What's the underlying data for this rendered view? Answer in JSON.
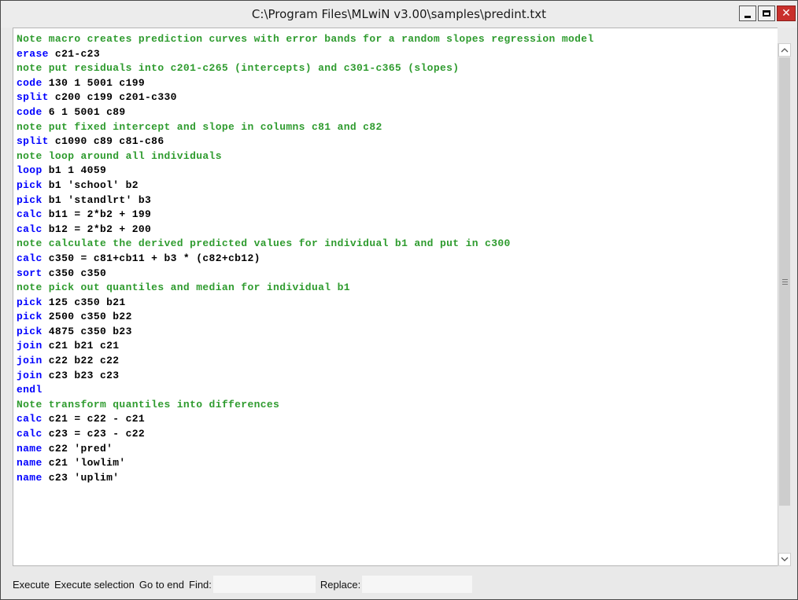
{
  "window": {
    "title": "C:\\Program Files\\MLwiN v3.00\\samples\\predint.txt",
    "controls": {
      "minimize": "minimize-icon",
      "maximize": "maximize-icon",
      "close": "close-icon"
    }
  },
  "colors": {
    "note": "#2e9b2e",
    "keyword": "#0000ff",
    "text": "#000000",
    "close": "#c9302c"
  },
  "editor": {
    "lines": [
      {
        "type": "note",
        "text": "Note macro creates prediction curves with error bands for a random slopes regression model"
      },
      {
        "type": "cmd",
        "kw": "erase",
        "rest": " c21-c23"
      },
      {
        "type": "note",
        "text": "note put residuals into c201-c265 (intercepts) and c301-c365 (slopes)"
      },
      {
        "type": "cmd",
        "kw": "code",
        "rest": " 130 1 5001 c199"
      },
      {
        "type": "cmd",
        "kw": "split",
        "rest": " c200 c199 c201-c330"
      },
      {
        "type": "cmd",
        "kw": "code",
        "rest": " 6 1 5001 c89"
      },
      {
        "type": "note",
        "text": "note put fixed intercept and slope in columns c81 and c82"
      },
      {
        "type": "cmd",
        "kw": "split",
        "rest": " c1090 c89 c81-c86"
      },
      {
        "type": "note",
        "text": "note loop around all individuals"
      },
      {
        "type": "cmd",
        "kw": "loop",
        "rest": " b1 1 4059"
      },
      {
        "type": "cmd",
        "kw": "pick",
        "rest": " b1 'school' b2"
      },
      {
        "type": "cmd",
        "kw": "pick",
        "rest": " b1 'standlrt' b3"
      },
      {
        "type": "cmd",
        "kw": "calc",
        "rest": " b11 = 2*b2 + 199"
      },
      {
        "type": "cmd",
        "kw": "calc",
        "rest": " b12 = 2*b2 + 200"
      },
      {
        "type": "note",
        "text": "note calculate the derived predicted values for individual b1 and put in c300"
      },
      {
        "type": "cmd",
        "kw": "calc",
        "rest": " c350 = c81+cb11 + b3 * (c82+cb12)"
      },
      {
        "type": "cmd",
        "kw": "sort",
        "rest": " c350 c350"
      },
      {
        "type": "note",
        "text": "note pick out quantiles and median for individual b1"
      },
      {
        "type": "cmd",
        "kw": "pick",
        "rest": " 125 c350 b21"
      },
      {
        "type": "cmd",
        "kw": "pick",
        "rest": " 2500 c350 b22"
      },
      {
        "type": "cmd",
        "kw": "pick",
        "rest": " 4875 c350 b23"
      },
      {
        "type": "cmd",
        "kw": "join",
        "rest": " c21 b21 c21"
      },
      {
        "type": "cmd",
        "kw": "join",
        "rest": " c22 b22 c22"
      },
      {
        "type": "cmd",
        "kw": "join",
        "rest": " c23 b23 c23"
      },
      {
        "type": "cmd",
        "kw": "endl",
        "rest": ""
      },
      {
        "type": "note",
        "text": "Note transform quantiles into differences"
      },
      {
        "type": "cmd",
        "kw": "calc",
        "rest": " c21 = c22 - c21"
      },
      {
        "type": "cmd",
        "kw": "calc",
        "rest": " c23 = c23 - c22"
      },
      {
        "type": "cmd",
        "kw": "name",
        "rest": " c22 'pred'"
      },
      {
        "type": "cmd",
        "kw": "name",
        "rest": " c21 'lowlim'"
      },
      {
        "type": "cmd",
        "kw": "name",
        "rest": " c23 'uplim'"
      }
    ]
  },
  "scrollbar": {
    "up": "chevron-up-icon",
    "down": "chevron-down-icon",
    "grip": "grip-icon"
  },
  "toolbar": {
    "execute": "Execute",
    "execute_selection": "Execute selection",
    "go_to_end": "Go to end",
    "find_label": "Find:",
    "find_value": "",
    "replace_label": "Replace:",
    "replace_value": ""
  }
}
